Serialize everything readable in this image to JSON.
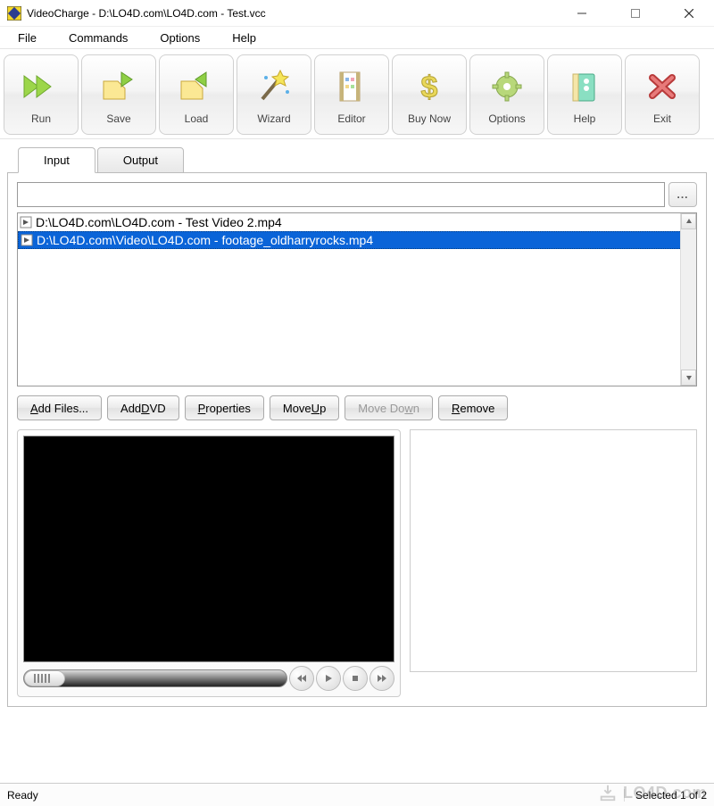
{
  "window": {
    "title": "VideoCharge - D:\\LO4D.com\\LO4D.com - Test.vcc"
  },
  "menu": {
    "file": "File",
    "commands": "Commands",
    "options": "Options",
    "help": "Help"
  },
  "toolbar": {
    "run": "Run",
    "save": "Save",
    "load": "Load",
    "wizard": "Wizard",
    "editor": "Editor",
    "buynow": "Buy Now",
    "options": "Options",
    "help": "Help",
    "exit": "Exit"
  },
  "tabs": {
    "input": "Input",
    "output": "Output"
  },
  "path_row": {
    "value": "",
    "browse": "..."
  },
  "files": [
    {
      "path": "D:\\LO4D.com\\LO4D.com - Test Video 2.mp4",
      "selected": false
    },
    {
      "path": "D:\\LO4D.com\\Video\\LO4D.com - footage_oldharryrocks.mp4",
      "selected": true
    }
  ],
  "buttons": {
    "add_files_pre": "",
    "add_files_u": "A",
    "add_files_post": "dd Files...",
    "add_dvd_pre": "Add ",
    "add_dvd_u": "D",
    "add_dvd_post": "VD",
    "properties_pre": "",
    "properties_u": "P",
    "properties_post": "roperties",
    "moveup_pre": "Move ",
    "moveup_u": "U",
    "moveup_post": "p",
    "movedown_pre": "Move Do",
    "movedown_u": "w",
    "movedown_post": "n",
    "remove_pre": "",
    "remove_u": "R",
    "remove_post": "emove"
  },
  "status": {
    "left": "Ready",
    "right": "Selected 1 of 2"
  },
  "watermark": {
    "text": "LO4D.com"
  }
}
